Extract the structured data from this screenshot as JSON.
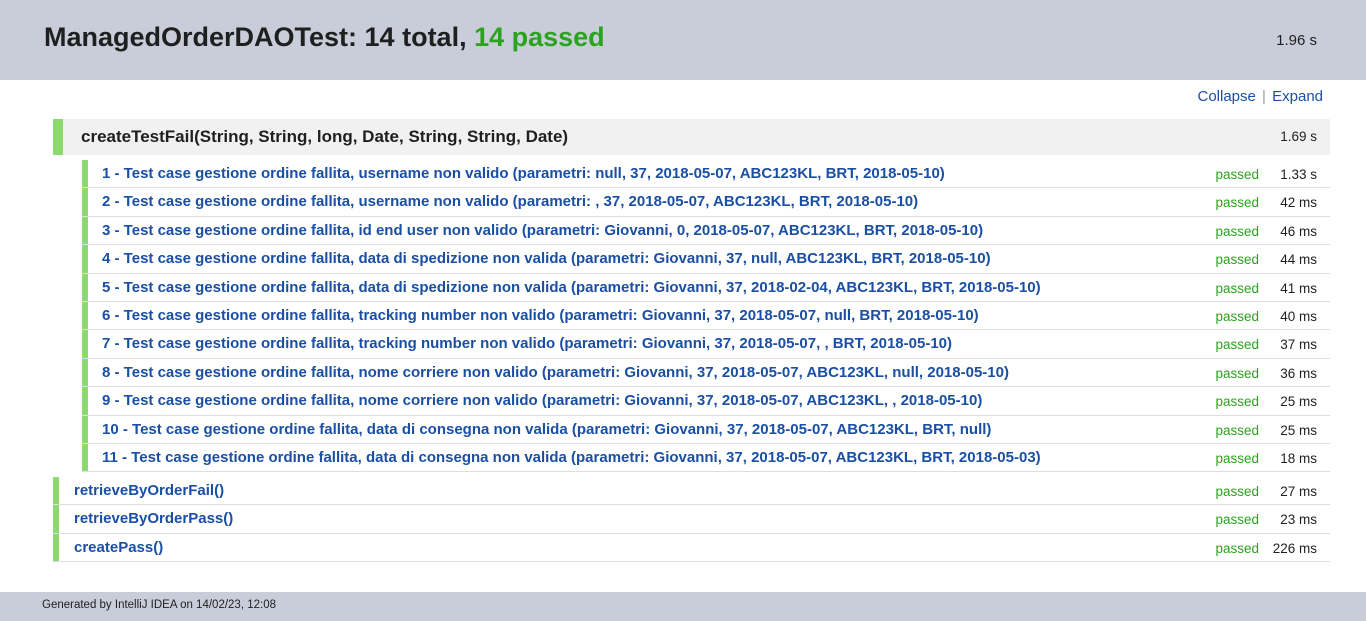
{
  "header": {
    "title_prefix": "ManagedOrderDAOTest: 14 total, ",
    "title_passed": "14 passed",
    "total_time": "1.96 s"
  },
  "toolbar": {
    "collapse_label": "Collapse",
    "separator": "|",
    "expand_label": "Expand"
  },
  "group": {
    "name": "createTestFail(String, String, long, Date, String, String, Date)",
    "time": "1.69 s",
    "cases": [
      {
        "name": "1 - Test case gestione ordine fallita, username non valido (parametri: null, 37, 2018-05-07, ABC123KL, BRT, 2018-05-10)",
        "status": "passed",
        "time": "1.33 s"
      },
      {
        "name": "2 - Test case gestione ordine fallita, username non valido (parametri: , 37, 2018-05-07, ABC123KL, BRT, 2018-05-10)",
        "status": "passed",
        "time": "42 ms"
      },
      {
        "name": "3 - Test case gestione ordine fallita, id end user non valido (parametri: Giovanni, 0, 2018-05-07, ABC123KL, BRT, 2018-05-10)",
        "status": "passed",
        "time": "46 ms"
      },
      {
        "name": "4 - Test case gestione ordine fallita, data di spedizione non valida (parametri: Giovanni, 37, null, ABC123KL, BRT, 2018-05-10)",
        "status": "passed",
        "time": "44 ms"
      },
      {
        "name": "5 - Test case gestione ordine fallita, data di spedizione non valida (parametri: Giovanni, 37, 2018-02-04, ABC123KL, BRT, 2018-05-10)",
        "status": "passed",
        "time": "41 ms"
      },
      {
        "name": "6 - Test case gestione ordine fallita, tracking number non valido (parametri: Giovanni, 37, 2018-05-07, null, BRT, 2018-05-10)",
        "status": "passed",
        "time": "40 ms"
      },
      {
        "name": "7 - Test case gestione ordine fallita, tracking number non valido (parametri: Giovanni, 37, 2018-05-07, , BRT, 2018-05-10)",
        "status": "passed",
        "time": "37 ms"
      },
      {
        "name": "8 - Test case gestione ordine fallita, nome corriere non valido (parametri: Giovanni, 37, 2018-05-07, ABC123KL, null, 2018-05-10)",
        "status": "passed",
        "time": "36 ms"
      },
      {
        "name": "9 - Test case gestione ordine fallita, nome corriere non valido (parametri: Giovanni, 37, 2018-05-07, ABC123KL, , 2018-05-10)",
        "status": "passed",
        "time": "25 ms"
      },
      {
        "name": "10 - Test case gestione ordine fallita, data di consegna non valida (parametri: Giovanni, 37, 2018-05-07, ABC123KL, BRT, null)",
        "status": "passed",
        "time": "25 ms"
      },
      {
        "name": "11 - Test case gestione ordine fallita, data di consegna non valida (parametri: Giovanni, 37, 2018-05-07, ABC123KL, BRT, 2018-05-03)",
        "status": "passed",
        "time": "18 ms"
      }
    ]
  },
  "methods": [
    {
      "name": "retrieveByOrderFail()",
      "status": "passed",
      "time": "27 ms"
    },
    {
      "name": "retrieveByOrderPass()",
      "status": "passed",
      "time": "23 ms"
    },
    {
      "name": "createPass()",
      "status": "passed",
      "time": "226 ms"
    }
  ],
  "footer": {
    "generated_text": "Generated by IntelliJ IDEA on 14/02/23, 12:08"
  },
  "colors": {
    "passed": "#2ba31e",
    "status_bar": "#8bd96f",
    "link": "#1a4fa3",
    "header_bg": "#c8cdd9"
  }
}
